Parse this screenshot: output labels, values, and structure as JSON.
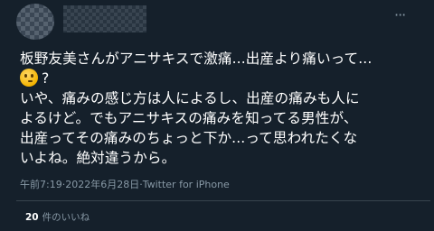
{
  "tweet": {
    "lines": [
      "板野友美さんがアニサキスで激痛...出産より痛いって...",
      "?",
      "いや、痛みの感じ方は人によるし、出産の痛みも人に",
      "よるけど。でもアニサキスの痛みを知ってる男性が、",
      "出産ってその痛みのちょっと下か...って思われたくな",
      "いよね。絶対違うから。"
    ],
    "emoji_icon": "thinking-face-emoji",
    "time": "午前7:19",
    "separator_1": " · ",
    "date": "2022年6月28日",
    "separator_2": " · ",
    "source": "Twitter for iPhone",
    "like_count": "20",
    "like_label": "件のいいね"
  },
  "colors": {
    "background": "#15202b",
    "text": "#ffffff",
    "secondary_text": "#8899a6",
    "divider": "#38444d"
  }
}
